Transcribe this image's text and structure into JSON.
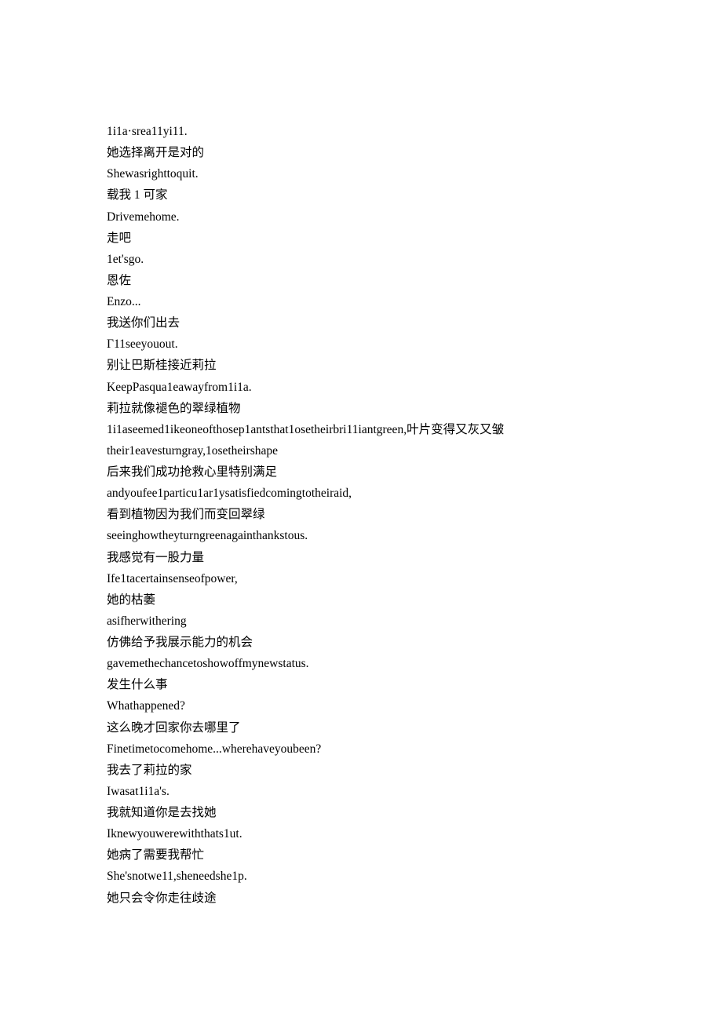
{
  "lines": [
    "1i1a·srea11yi11.",
    "她选择离开是对的",
    "Shewasrighttoquit.",
    "载我 1 可家",
    "Drivemehome.",
    "走吧",
    "1et'sgo.",
    "恩佐",
    "Enzo...",
    "我送你们出去",
    "Γ11seeyouout.",
    "别让巴斯桂接近莉拉",
    "KeepPasqua1eawayfrom1i1a.",
    "莉拉就像褪色的翠绿植物",
    "1i1aseemed1ikeoneofthosep1antsthat1osetheirbri11iantgreen,叶片变得又灰又皱",
    "their1eavesturngray,1osetheirshape",
    "后来我们成功抢救心里特别满足",
    "andyoufee1particu1ar1ysatisfiedcomingtotheiraid,",
    "看到植物因为我们而变回翠绿",
    "seeinghowtheyturngreenagainthankstous.",
    "我感觉有一股力量",
    "Ife1tacertainsenseofpower,",
    "她的枯萎",
    "asifherwithering",
    "仿佛给予我展示能力的机会",
    "gavemethechancetoshowoffmynewstatus.",
    "发生什么事",
    "Whathappened?",
    "这么晚才回家你去哪里了",
    "Finetimetocomehome...wherehaveyoubeen?",
    "我去了莉拉的家",
    "Iwasat1i1a's.",
    "我就知道你是去找她",
    "Iknewyouwerewiththats1ut.",
    "她病了需要我帮忙",
    "She'snotwe11,sheneedshe1p.",
    "她只会令你走往歧途"
  ]
}
